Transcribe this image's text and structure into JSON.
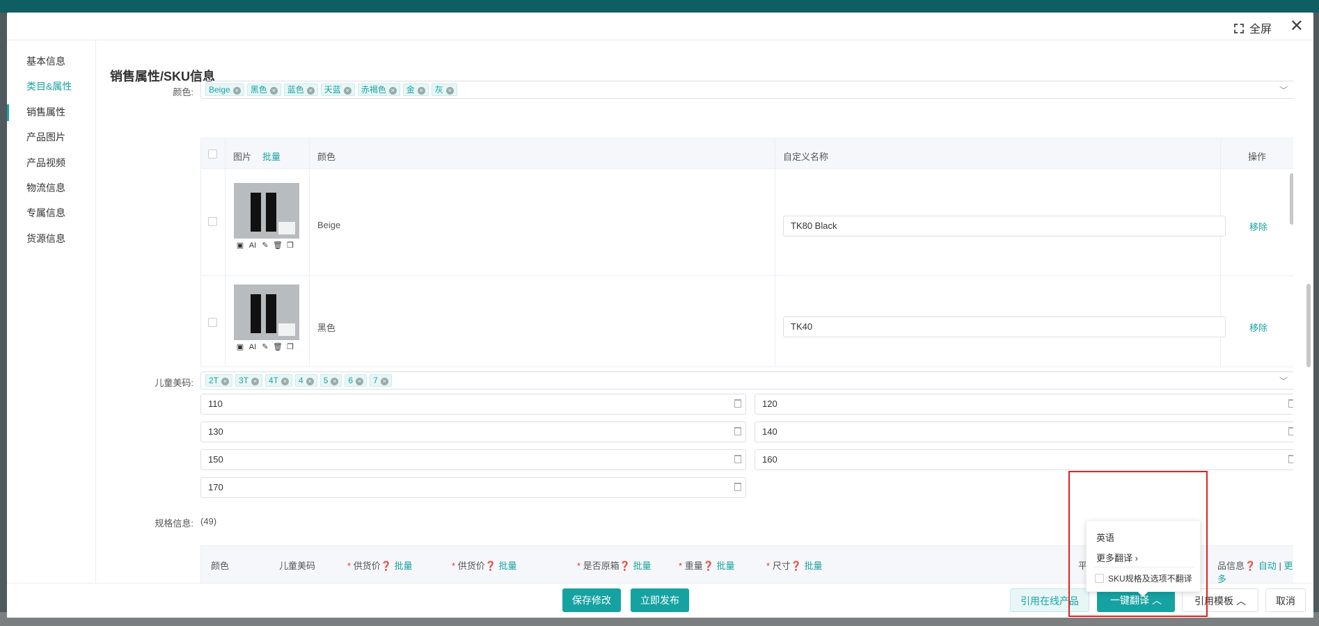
{
  "modal": {
    "fullscreen_label": "全屏"
  },
  "nav": [
    "基本信息",
    "类目&属性",
    "销售属性",
    "产品图片",
    "产品视频",
    "物流信息",
    "专属信息",
    "货源信息"
  ],
  "section_title": "销售属性/SKU信息",
  "color": {
    "label": "颜色:",
    "tags": [
      "Beige",
      "黑色",
      "蓝色",
      "天蓝",
      "赤褐色",
      "金",
      "灰"
    ]
  },
  "table": {
    "headers": {
      "image": "图片",
      "batch": "批量",
      "color": "颜色",
      "custom": "自定义名称",
      "op": "操作"
    },
    "rows": [
      {
        "color": "Beige",
        "custom": "TK80 Black",
        "remove": "移除"
      },
      {
        "color": "黑色",
        "custom": "TK40",
        "remove": "移除"
      }
    ],
    "tools": [
      "AI"
    ]
  },
  "size": {
    "label": "儿童美码:",
    "tags": [
      "2T",
      "3T",
      "4T",
      "4",
      "5",
      "6",
      "7"
    ],
    "values": [
      "110",
      "120",
      "130",
      "140",
      "150",
      "160",
      "170"
    ]
  },
  "spec": {
    "label": "规格信息:",
    "count": "(49)",
    "headers": [
      "颜色",
      "儿童美码",
      "供货价",
      "批量",
      "供货价",
      "批量",
      "是否原箱",
      "批量",
      "重量",
      "批量",
      "尺寸",
      "批量",
      "平台SKU",
      "自动",
      "更多",
      "品信息",
      "自动",
      "更多"
    ],
    "star": "*"
  },
  "popup": {
    "english": "英语",
    "more": "更多翻译",
    "no_translate": "SKU规格及选项不翻译"
  },
  "footer": {
    "save": "保存修改",
    "publish": "立即发布",
    "cite_online": "引用在线产品",
    "translate": "一键翻译",
    "template": "引用模板",
    "cancel": "取消"
  }
}
